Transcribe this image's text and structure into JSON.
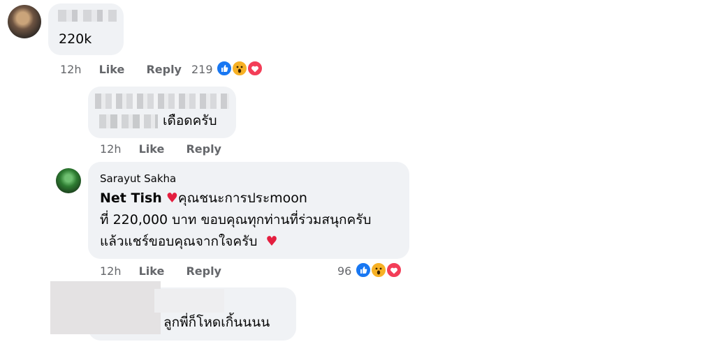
{
  "comments": [
    {
      "author_hidden": true,
      "text": "220k",
      "time": "12h",
      "like": "Like",
      "reply": "Reply",
      "reaction_count": "219",
      "reactions": [
        "like-icon",
        "wow-icon",
        "love-icon"
      ]
    },
    {
      "author_hidden": true,
      "text": "เดือดครับ",
      "time": "12h",
      "like": "Like",
      "reply": "Reply"
    },
    {
      "author": "Sarayut Sakha",
      "mention": "Net Tish",
      "line1": "คุณชนะการประmoon",
      "line2": "ที่ 220,000 บาท ขอบคุณทุกท่านที่ร่วมสนุกครับ",
      "line3": "แล้วแชร์ขอบคุณจากใจครับ",
      "time": "12h",
      "like": "Like",
      "reply": "Reply",
      "reaction_count": "96",
      "reactions": [
        "like-icon",
        "wow-icon",
        "love-icon"
      ]
    },
    {
      "author_hidden": true,
      "text": "ลูกพี่ก็โหดเกิ้นนนน"
    }
  ],
  "colors": {
    "bubble": "#f0f2f5",
    "meta": "#65676b",
    "like_blue": "#1877f2",
    "wow_yellow": "#f7b125",
    "love_red": "#f33e58"
  }
}
